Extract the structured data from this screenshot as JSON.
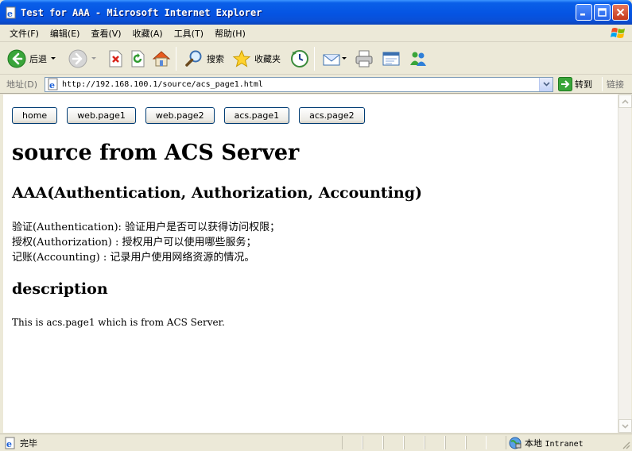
{
  "window": {
    "title": "Test for AAA - Microsoft Internet Explorer",
    "colors": {
      "titlebar": "#0554e3",
      "close": "#c5391c"
    }
  },
  "menubar": {
    "items": [
      "文件(F)",
      "编辑(E)",
      "查看(V)",
      "收藏(A)",
      "工具(T)",
      "帮助(H)"
    ]
  },
  "toolbar": {
    "back_label": "后退",
    "search_label": "搜索",
    "favorites_label": "收藏夹"
  },
  "addressbar": {
    "label": "地址(D)",
    "url": "http://192.168.100.1/source/acs_page1.html",
    "go_label": "转到",
    "links_label": "链接"
  },
  "page": {
    "nav_buttons": [
      "home",
      "web.page1",
      "web.page2",
      "acs.page1",
      "acs.page2"
    ],
    "heading": "source from ACS Server",
    "subheading": "AAA(Authentication, Authorization, Accounting)",
    "definitions": [
      "验证(Authentication): 验证用户是否可以获得访问权限；",
      "授权(Authorization) : 授权用户可以使用哪些服务；",
      "记账(Accounting) : 记录用户使用网络资源的情况。"
    ],
    "description_heading": "description",
    "description_text": "This is acs.page1 which is from ACS Server."
  },
  "statusbar": {
    "status": "完毕",
    "zone_label": "本地",
    "zone_name": "Intranet"
  }
}
